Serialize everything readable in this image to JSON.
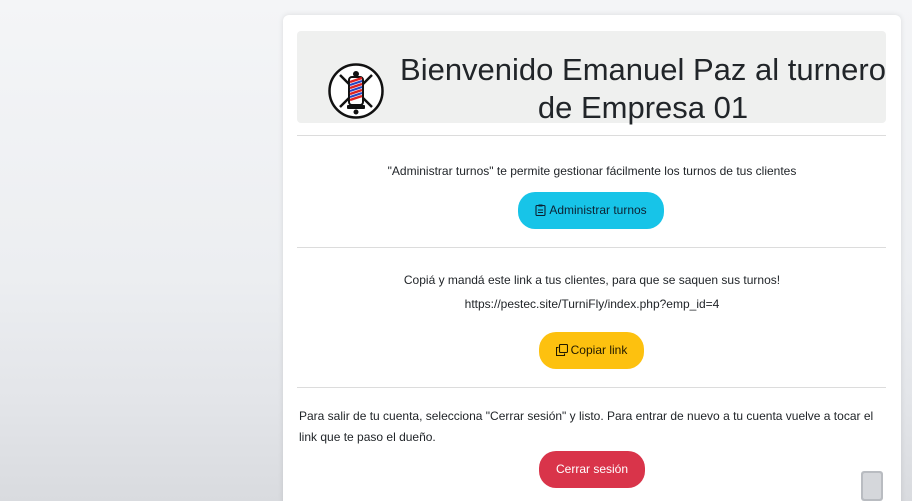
{
  "header": {
    "title": "Bienvenido Emanuel Paz al turnero de Empresa 01",
    "logo_icon": "barber-pole-icon"
  },
  "admin_section": {
    "description": "\"Administrar turnos\" te permite gestionar fácilmente los turnos de tus clientes",
    "button_label": "Administrar turnos",
    "button_icon": "clipboard-icon",
    "button_color": "#17c4e8"
  },
  "link_section": {
    "description": "Copiá y mandá este link a tus clientes, para que se saquen sus turnos!",
    "url": "https://pestec.site/TurniFly/index.php?emp_id=4",
    "button_label": "Copiar link",
    "button_icon": "copy-icon",
    "button_color": "#fdc10f"
  },
  "logout_section": {
    "description": "Para salir de tu cuenta, selecciona \"Cerrar sesión\" y listo. Para entrar de nuevo a tu cuenta vuelve a tocar el link que te paso el dueño.",
    "button_label": "Cerrar sesión",
    "button_color": "#d9344a"
  }
}
